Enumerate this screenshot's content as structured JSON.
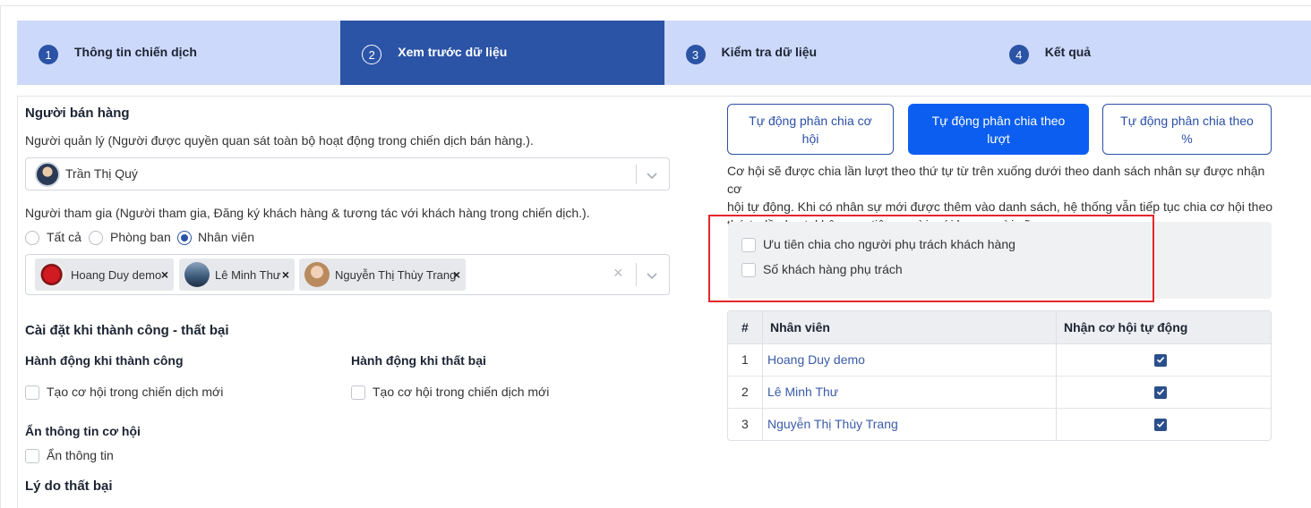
{
  "steps": [
    {
      "num": "1",
      "label": "Thông tin chiến dịch"
    },
    {
      "num": "2",
      "label": "Xem trước dữ liệu"
    },
    {
      "num": "3",
      "label": "Kiểm tra dữ liệu"
    },
    {
      "num": "4",
      "label": "Kết quả"
    }
  ],
  "sales": {
    "title": "Người bán hàng",
    "manager_label": "Người quản lý (Người được quyền quan sát toàn bộ hoạt động trong chiến dịch bán hàng.).",
    "manager_value": "Trần Thị Quý",
    "participant_label": "Người tham gia (Người tham gia, Đăng ký khách hàng & tương tác với khách hàng trong chiến dịch.).",
    "radio_options": [
      "Tất cả",
      "Phòng ban",
      "Nhân viên"
    ],
    "radio_selected": "Nhân viên",
    "participants": [
      "Hoang Duy demo",
      "Lê Minh Thư",
      "Nguyễn Thị Thùy Trang"
    ],
    "chip_remove": "×",
    "clear_all": "×"
  },
  "outcome": {
    "title": "Cài đặt khi thành công - thất bại",
    "success_heading": "Hành động khi thành công",
    "success_option": "Tạo cơ hội trong chiến dịch mới",
    "fail_heading": "Hành động khi thất bại",
    "fail_option": "Tạo cơ hội trong chiến dịch mới",
    "hide_heading": "Ẩn thông tin cơ hội",
    "hide_option": "Ẩn thông tin",
    "reason_heading": "Lý do thất bại"
  },
  "distribution": {
    "modes": [
      {
        "line1": "Tự động phân chia cơ",
        "line2": "hội"
      },
      {
        "line1": "Tự động phân chia theo",
        "line2": "lượt"
      },
      {
        "line1": "Tự động phân chia theo",
        "line2": "%"
      }
    ],
    "active_mode": 1,
    "description_lines": [
      "Cơ hội sẽ được chia lần lượt theo thứ tự từ trên xuống dưới theo danh sách nhân sự được nhận cơ",
      "hội tự động. Khi có nhân sự mới được thêm vào danh sách, hệ thống vẫn tiếp tục chia cơ hội theo",
      "thứ tự lần lượt, không ưu tiên người mới hay người cũ."
    ],
    "priority_options": [
      "Ưu tiên chia cho người phụ trách khách hàng",
      "Số khách hàng phụ trách"
    ]
  },
  "table": {
    "headers": [
      "#",
      "Nhân viên",
      "Nhận cơ hội tự động"
    ],
    "rows": [
      {
        "index": "1",
        "name": "Hoang Duy demo",
        "auto": true
      },
      {
        "index": "2",
        "name": "Lê Minh Thư",
        "auto": true
      },
      {
        "index": "3",
        "name": "Nguyễn Thị Thùy Trang",
        "auto": true
      }
    ]
  },
  "colors": {
    "primary": "#2b53a6",
    "step_inactive": "#cdd9fb",
    "active_button": "#0b5ef0",
    "highlight": "#e3262d"
  }
}
